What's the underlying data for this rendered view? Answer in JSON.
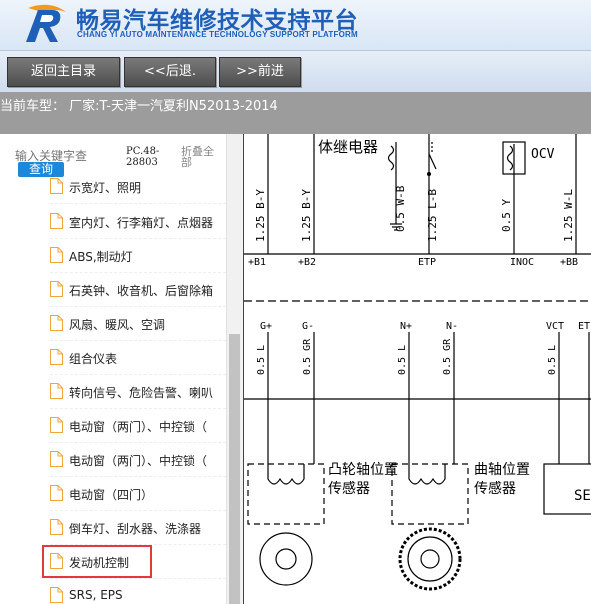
{
  "header": {
    "title_zh": "畅易汽车维修技术支持平台",
    "title_en": "CHANG YI AUTO MAINTENANCE TECHNOLOGY SUPPORT PLATFORM"
  },
  "toolbar": {
    "home_label": "返回主目录",
    "back_label": "<<后退.",
    "forward_label": ">>前进"
  },
  "model_bar": {
    "text": "当前车型： 厂家:T-天津一汽夏利N52013-2014"
  },
  "search": {
    "placeholder": "输入关键字查",
    "button_label": "查询",
    "pc_label": "PC.48-28803",
    "fold_label": "折叠全部"
  },
  "tree": {
    "items": [
      {
        "label": "示宽灯、照明"
      },
      {
        "label": "室内灯、行李箱灯、点烟器"
      },
      {
        "label": "ABS,制动灯"
      },
      {
        "label": "石英钟、收音机、后窗除箱"
      },
      {
        "label": "风扇、暖风、空调"
      },
      {
        "label": "组合仪表"
      },
      {
        "label": "转向信号、危险告警、喇叭"
      },
      {
        "label": "电动窗（两门）、中控锁（"
      },
      {
        "label": "电动窗（两门）、中控锁（"
      },
      {
        "label": "电动窗（四门）"
      },
      {
        "label": "倒车灯、刮水器、洗涤器"
      },
      {
        "label": "发动机控制"
      },
      {
        "label": "SRS, EPS"
      }
    ],
    "selected_index": 11
  },
  "diagram": {
    "labels": {
      "relay": "体继电器",
      "ocv": "OCV",
      "wire_125_by_1": "1.25 B-Y",
      "wire_125_by_2": "1.25 B-Y",
      "wire_05_wb": "0.5 W-B",
      "wire_125_lb": "1.25 L-B",
      "wire_05_y": "0.5 Y",
      "wire_125_wl": "1.25 W-L",
      "term_b1": "+B1",
      "term_b2": "+B2",
      "term_etp": "ETP",
      "term_inoc": "INOC",
      "term_bb": "+BB",
      "pin_gp": "G+",
      "pin_gm": "G-",
      "pin_np": "N+",
      "pin_nm": "N-",
      "pin_vct": "VCT",
      "pin_et": "ET",
      "w_05l_1": "0.5 L",
      "w_05gr_1": "0.5 GR",
      "w_05l_2": "0.5 L",
      "w_05gr_2": "0.5 GR",
      "w_05l_3": "0.5 L",
      "cam_sensor_1": "凸轮轴位置",
      "cam_sensor_2": "传感器",
      "crank_sensor_1": "曲轴位置",
      "crank_sensor_2": "传感器",
      "se": "SE"
    }
  },
  "colors": {
    "brand_blue": "#1f5fb8",
    "search_button": "#1e88d8",
    "model_bar_bg": "#9c9c9c",
    "selection_border": "#e23a3a"
  }
}
